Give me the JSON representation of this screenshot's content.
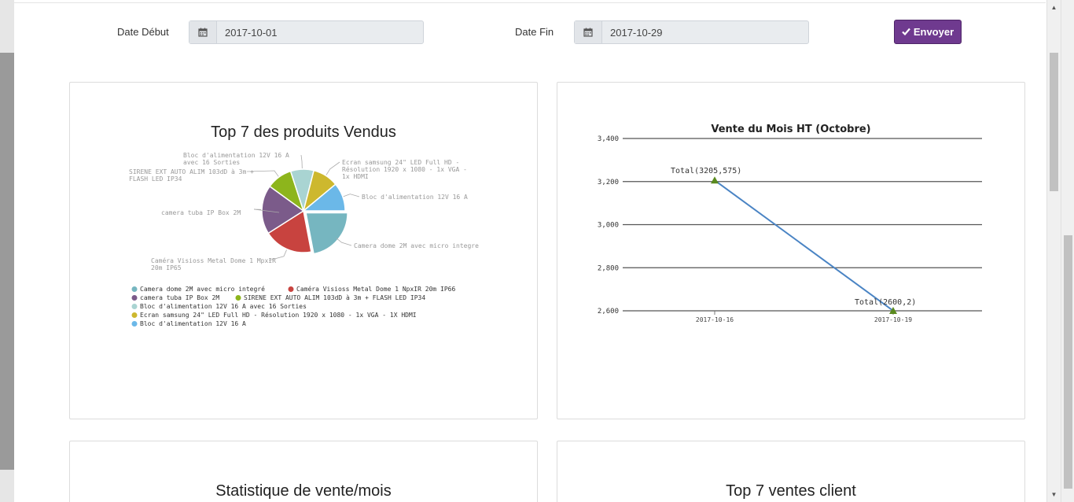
{
  "filters": {
    "date_start_label": "Date Début",
    "date_start_value": "2017-10-01",
    "date_end_label": "Date Fin",
    "date_end_value": "2017-10-29",
    "submit_label": "Envoyer"
  },
  "panels": {
    "top_products": {
      "title": "Top 7 des produits Vendus"
    },
    "sales_month": {
      "title": "Vente du Mois HT (Octobre)"
    },
    "sales_stats": {
      "title": "Statistique de vente/mois"
    },
    "top_clients": {
      "title": "Top 7 ventes client"
    }
  },
  "chart_data": [
    {
      "type": "pie",
      "title": "Top 7 des produits Vendus",
      "legend_placement": "bottom",
      "slices": [
        {
          "label": "Camera dome 2M avec micro integré",
          "value": 22,
          "color": "#76b6c0"
        },
        {
          "label": "Caméra Visioss Metal Dome 1 MpxIR 20m IP66",
          "value": 19,
          "color": "#c8433f"
        },
        {
          "label": "camera tuba IP Box 2M",
          "value": 19,
          "color": "#7b5b8a"
        },
        {
          "label": "SIRENE EXT AUTO ALIM 103dD à 3m + FLASH LED IP34",
          "value": 10,
          "color": "#8db51c"
        },
        {
          "label": "Bloc d'alimentation 12V 16 A avec 16 Sorties",
          "value": 9,
          "color": "#a9d4d2"
        },
        {
          "label": "Ecran samsung 24\" LED Full HD - Résolution 1920 x 1080 - 1x VGA - 1x HDMI",
          "value": 10,
          "color": "#cdb82e"
        },
        {
          "label": "Bloc d'alimentation 12V 16 A",
          "value": 11,
          "color": "#6bb8e8"
        }
      ],
      "callouts": [
        "Camera dome 2M avec micro integre",
        "Caméra Visioss Metal Dome 1 MpxIR",
        "20m IP65",
        "camera tuba IP Box 2M",
        "SIRENE EXT AUTO ALIM 103dD à 3m +",
        "FLASH LED IP34",
        "Bloc d'alimentation  12V 16 A",
        "avec 16 Sorties",
        "Ecran samsung 24\" LED Full HD -",
        "Résolution 1920 x 1080 - 1x VGA -",
        "1x HDMI",
        "Bloc d'alimentation 12V 16 A"
      ],
      "legend": [
        "Camera dome 2M avec micro integré",
        "Caméra Visioss Metal Dome 1 NpxIR 20m IP66",
        "camera tuba IP Box 2M",
        "SIRENE EXT AUTO ALIM 103dD à 3m + FLASH LED IP34",
        "Bloc d'alimentation  12V 16 A avec 16 Sorties",
        "Ecran samsung 24\" LED Full HD - Résolution 1920 x 1080 - 1x VGA - 1X HDMI",
        "Bloc d'alimentation 12V 16 A"
      ]
    },
    {
      "type": "line",
      "title": "Vente du Mois HT (Octobre)",
      "categories": [
        "2017-10-16",
        "2017-10-19"
      ],
      "series": [
        {
          "values": [
            3205.575,
            2600.2
          ],
          "color": "#4a84c4",
          "marker_color": "#5a8a1e"
        }
      ],
      "point_labels": [
        "Total(3205,575)",
        "Total(2600,2)"
      ],
      "yticks": [
        "2,600",
        "2,800",
        "3,000",
        "3,200",
        "3,400"
      ],
      "ytick_values": [
        2600,
        2800,
        3000,
        3200,
        3400
      ],
      "ylim": [
        2600,
        3400
      ],
      "grid": true
    }
  ]
}
